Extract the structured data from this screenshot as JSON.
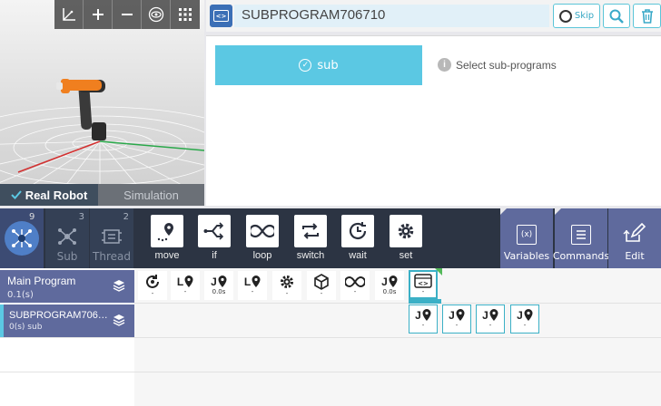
{
  "viewport": {
    "toolbar": [
      "axis-icon",
      "zoom-in-icon",
      "zoom-out-icon",
      "eye-icon",
      "grid-icon"
    ],
    "real_robot_label": "Real Robot",
    "simulation_label": "Simulation"
  },
  "header": {
    "program_name": "SUBPROGRAM706710",
    "skip_label": "Skip"
  },
  "properties": {
    "sub_button_label": "sub",
    "select_hint": "Select sub-programs"
  },
  "tabs": {
    "main_count": "9",
    "sub_label": "Sub",
    "sub_count": "3",
    "thread_label": "Thread",
    "thread_count": "2"
  },
  "commands": [
    {
      "name": "move",
      "label": "move"
    },
    {
      "name": "if",
      "label": "if"
    },
    {
      "name": "loop",
      "label": "loop"
    },
    {
      "name": "switch",
      "label": "switch"
    },
    {
      "name": "wait",
      "label": "wait"
    },
    {
      "name": "set",
      "label": "set"
    }
  ],
  "tools": {
    "variables": "Variables",
    "commands": "Commands",
    "edit": "Edit"
  },
  "tree": {
    "main_program": {
      "title": "Main Program",
      "subtitle": "0.1(s)"
    },
    "subprogram": {
      "title": "SUBPROGRAM706…",
      "subtitle": "0(s) sub"
    },
    "main_cells": [
      {
        "icon": "rotate-icon",
        "sub": "-"
      },
      {
        "icon": "move-l-icon",
        "prefix": "L",
        "sub": "-"
      },
      {
        "icon": "move-j-icon",
        "prefix": "J",
        "sub": "0.0s"
      },
      {
        "icon": "move-l-icon",
        "prefix": "L",
        "sub": "-"
      },
      {
        "icon": "gear-icon",
        "sub": "-"
      },
      {
        "icon": "cube-icon",
        "sub": "-"
      },
      {
        "icon": "loop-icon",
        "sub": "-"
      },
      {
        "icon": "move-j-icon",
        "prefix": "J",
        "sub": "0.0s"
      },
      {
        "icon": "subprogram-icon",
        "sub": "-"
      }
    ],
    "sub_cells": [
      {
        "icon": "move-j-icon",
        "prefix": "J",
        "sub": "-"
      },
      {
        "icon": "move-j-icon",
        "prefix": "J",
        "sub": "-"
      },
      {
        "icon": "move-j-icon",
        "prefix": "J",
        "sub": "-"
      },
      {
        "icon": "move-j-icon",
        "prefix": "J",
        "sub": "-"
      }
    ]
  }
}
